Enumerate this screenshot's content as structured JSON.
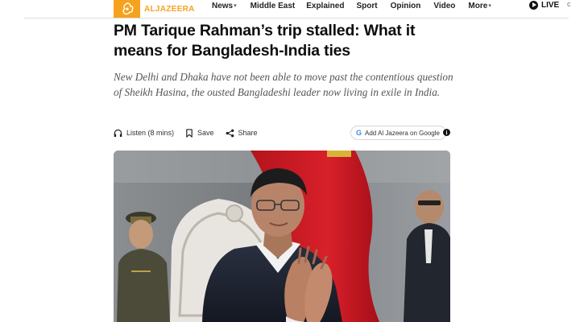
{
  "brand": {
    "name": "ALJAZEERA",
    "accent": "#f6a21e"
  },
  "nav": {
    "items": [
      {
        "label": "News",
        "dropdown": true
      },
      {
        "label": "Middle East",
        "dropdown": false
      },
      {
        "label": "Explained",
        "dropdown": false
      },
      {
        "label": "Sport",
        "dropdown": false
      },
      {
        "label": "Opinion",
        "dropdown": false
      },
      {
        "label": "Video",
        "dropdown": false
      },
      {
        "label": "More",
        "dropdown": true
      }
    ],
    "live_label": "LIVE"
  },
  "article": {
    "headline": "PM Tarique Rahman’s trip stalled: What it means for Bangladesh-India ties",
    "deck": "New Delhi and Dhaka have not been able to move past the contentious question of Sheikh Hasina, the ousted Bangladeshi leader now living in exile in India.",
    "actions": {
      "listen_label": "Listen (8 mins)",
      "save_label": "Save",
      "share_label": "Share",
      "google_label": "Add Al Jazeera on Google"
    },
    "hero_image": {
      "description_icon": "photo-of-man-clapping"
    }
  }
}
